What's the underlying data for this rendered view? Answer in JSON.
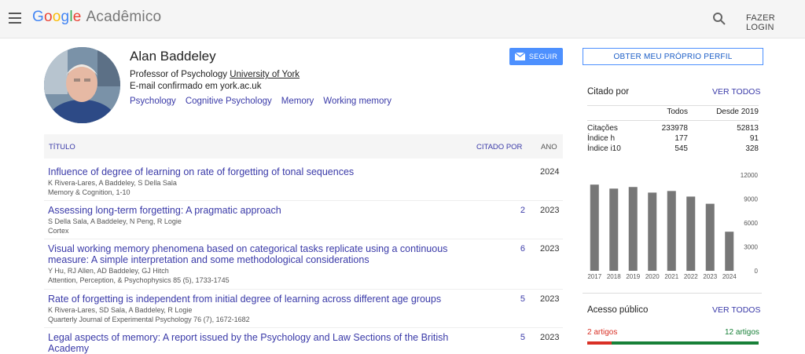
{
  "header": {
    "logo_google": [
      "G",
      "o",
      "o",
      "g",
      "l",
      "e"
    ],
    "logo_product": "Acadêmico",
    "login_label": "FAZER LOGIN"
  },
  "profile": {
    "name": "Alan Baddeley",
    "affiliation_prefix": "Professor of Psychology ",
    "affiliation_link": "University of York",
    "email": "E-mail confirmado em york.ac.uk",
    "interests": [
      "Psychology",
      "Cognitive Psychology",
      "Memory",
      "Working memory"
    ],
    "follow_label": "SEGUIR"
  },
  "table": {
    "col_title": "TÍTULO",
    "col_cited": "CITADO POR",
    "col_year": "ANO",
    "rows": [
      {
        "title": "Influence of degree of learning on rate of forgetting of tonal sequences",
        "authors": "K Rivera-Lares, A Baddeley, S Della Sala",
        "venue": "Memory & Cognition, 1-10",
        "cites": "",
        "year": "2024"
      },
      {
        "title": "Assessing long-term forgetting: A pragmatic approach",
        "authors": "S Della Sala, A Baddeley, N Peng, R Logie",
        "venue": "Cortex",
        "cites": "2",
        "year": "2023"
      },
      {
        "title": "Visual working memory phenomena based on categorical tasks replicate using a continuous measure: A simple interpretation and some methodological considerations",
        "authors": "Y Hu, RJ Allen, AD Baddeley, GJ Hitch",
        "venue": "Attention, Perception, & Psychophysics 85 (5), 1733-1745",
        "cites": "6",
        "year": "2023"
      },
      {
        "title": "Rate of forgetting is independent from initial degree of learning across different age groups",
        "authors": "K Rivera-Lares, SD Sala, A Baddeley, R Logie",
        "venue": "Quarterly Journal of Experimental Psychology 76 (7), 1672-1682",
        "cites": "5",
        "year": "2023"
      },
      {
        "title": "Legal aspects of memory: A report issued by the Psychology and Law Sections of the British Academy",
        "authors": "",
        "venue": "",
        "cites": "5",
        "year": "2023"
      }
    ]
  },
  "sidebar": {
    "own_profile_label": "OBTER MEU PRÓPRIO PERFIL",
    "cited_by_title": "Citado por",
    "view_all": "VER TODOS",
    "stats_header": [
      "Todos",
      "Desde 2019"
    ],
    "stats": [
      {
        "label": "Citações",
        "all": "233978",
        "since": "52813"
      },
      {
        "label": "Índice h",
        "all": "177",
        "since": "91"
      },
      {
        "label": "Índice i10",
        "all": "545",
        "since": "328"
      }
    ],
    "public_access_title": "Acesso público",
    "articles_unavailable": "2 artigos",
    "articles_available": "12 artigos",
    "access_fraction_unavailable": 0.143
  },
  "chart_data": {
    "type": "bar",
    "categories": [
      "2017",
      "2018",
      "2019",
      "2020",
      "2021",
      "2022",
      "2023",
      "2024"
    ],
    "values": [
      10800,
      10300,
      10500,
      9800,
      10000,
      9300,
      8400,
      4900
    ],
    "ylim": [
      0,
      12000
    ],
    "yticks": [
      "12000",
      "9000",
      "6000",
      "3000",
      "0"
    ],
    "bar_color": "#777777"
  }
}
